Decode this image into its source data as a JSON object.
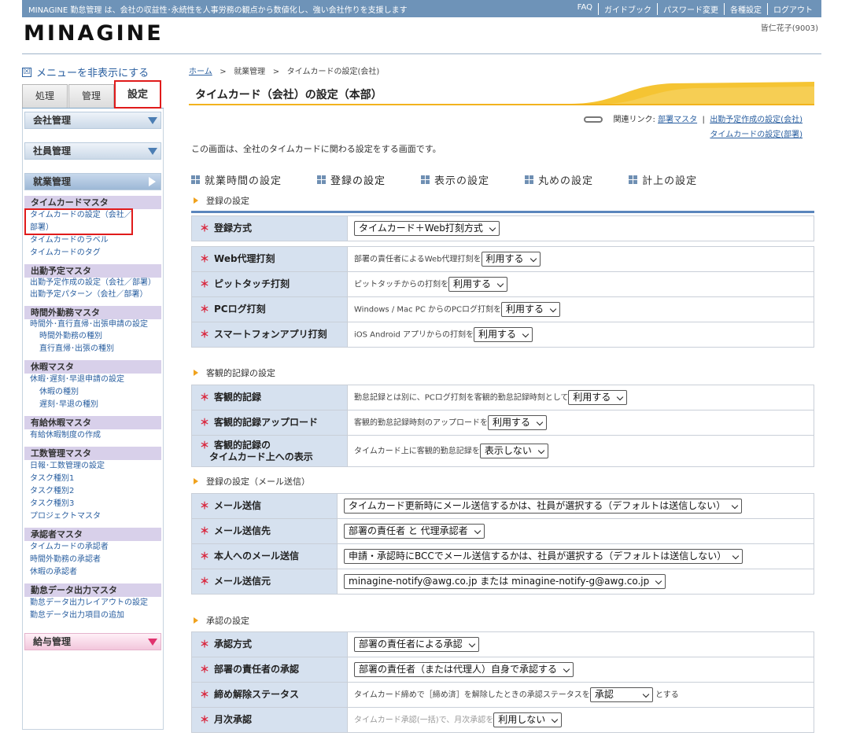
{
  "topbar": {
    "tagline": "MINAGINE 勤怠管理 は、会社の収益性･永続性を人事労務の観点から数値化し、強い会社作りを支援します",
    "links": [
      "FAQ",
      "ガイドブック",
      "パスワード変更",
      "各種設定",
      "ログアウト"
    ]
  },
  "logo": "MINAGINE",
  "user_name": "皆仁花子(9003)",
  "sidebar": {
    "hide_menu_icon": "☒",
    "hide_menu_label": "メニューを非表示にする",
    "tabs": [
      "処理",
      "管理",
      "設定"
    ],
    "heads": {
      "company": "会社管理",
      "employee": "社員管理",
      "attendance": "就業管理",
      "salary": "給与管理"
    },
    "groups": [
      {
        "title": "タイムカードマスタ",
        "links": [
          "タイムカードの設定（会社／部署）",
          "タイムカードのラベル",
          "タイムカードのタグ"
        ]
      },
      {
        "title": "出勤予定マスタ",
        "links": [
          "出勤予定作成の設定（会社／部署）",
          "出勤予定パターン（会社／部署）"
        ]
      },
      {
        "title": "時間外勤務マスタ",
        "links": [
          "時間外･直行直帰･出張申請の設定",
          "時間外勤務の種別",
          "直行直帰･出張の種別"
        ]
      },
      {
        "title": "休暇マスタ",
        "links": [
          "休暇･遅刻･早退申請の設定",
          "休暇の種別",
          "遅刻･早退の種別"
        ]
      },
      {
        "title": "有給休暇マスタ",
        "links": [
          "有給休暇制度の作成"
        ]
      },
      {
        "title": "工数管理マスタ",
        "links": [
          "日報･工数管理の設定",
          "タスク種別1",
          "タスク種別2",
          "タスク種別3",
          "プロジェクトマスタ"
        ]
      },
      {
        "title": "承認者マスタ",
        "links": [
          "タイムカードの承認者",
          "時間外勤務の承認者",
          "休暇の承認者"
        ]
      },
      {
        "title": "勤怠データ出力マスタ",
        "links": [
          "勤怠データ出力レイアウトの設定",
          "勤怠データ出力項目の追加"
        ]
      }
    ]
  },
  "breadcrumb": {
    "home": "ホーム",
    "sep": ">",
    "parent": "就業管理",
    "current": "タイムカードの設定(会社)"
  },
  "page_title": "タイムカード（会社）の設定（本部）",
  "related": {
    "label": "関連リンク:",
    "links": [
      "部署マスタ",
      "出勤予定作成の設定(会社)",
      "タイムカードの設定(部署)"
    ],
    "sep": "|"
  },
  "description": "この画面は、全社のタイムカードに関わる設定をする画面です。",
  "section_nav": [
    "就業時間の設定",
    "登録の設定",
    "表示の設定",
    "丸めの設定",
    "計上の設定"
  ],
  "required_mark": "＊",
  "sections": {
    "registration": {
      "title": "登録の設定",
      "method": {
        "label": "登録方式",
        "value": "タイムカード＋Web打刻方式"
      },
      "rows": [
        {
          "label": "Web代理打刻",
          "text": "部署の責任者によるWeb代理打刻を",
          "value": "利用する"
        },
        {
          "label": "ピットタッチ打刻",
          "text": "ピットタッチからの打刻を",
          "value": "利用する"
        },
        {
          "label": "PCログ打刻",
          "text": "Windows / Mac PC からのPCログ打刻を",
          "value": "利用する"
        },
        {
          "label": "スマートフォンアプリ打刻",
          "text": "iOS Android アプリからの打刻を",
          "value": "利用する"
        }
      ]
    },
    "objective": {
      "title": "客観的記録の設定",
      "rows": [
        {
          "label": "客観的記録",
          "text": "勤怠記録とは別に、PCログ打刻を客観的勤怠記録時刻として",
          "value": "利用する"
        },
        {
          "label": "客観的記録アップロード",
          "text": "客観的勤怠記録時刻のアップロードを",
          "value": "利用する"
        },
        {
          "label_line1": "客観的記録の",
          "label_line2": "タイムカード上への表示",
          "text": "タイムカード上に客観的勤怠記録を",
          "value": "表示しない"
        }
      ]
    },
    "mail": {
      "title": "登録の設定（メール送信）",
      "rows": [
        {
          "label": "メール送信",
          "value": "タイムカード更新時にメール送信するかは、社員が選択する（デフォルトは送信しない）"
        },
        {
          "label": "メール送信先",
          "value": "部署の責任者 と 代理承認者"
        },
        {
          "label": "本人へのメール送信",
          "value": "申請・承認時にBCCでメール送信するかは、社員が選択する（デフォルトは送信しない）"
        },
        {
          "label": "メール送信元",
          "value": "minagine-notify@awg.co.jp または minagine-notify-g@awg.co.jp"
        }
      ]
    },
    "approval": {
      "title": "承認の設定",
      "rows": [
        {
          "label": "承認方式",
          "value": "部署の責任者による承認"
        },
        {
          "label": "部署の責任者の承認",
          "value": "部署の責任者（または代理人）自身で承認する"
        },
        {
          "label": "締め解除ステータス",
          "text": "タイムカード締めで［締め済］を解除したときの承認ステータスを",
          "value": "承認",
          "suffix": "とする"
        },
        {
          "label": "月次承認",
          "text": "タイムカード承認(一括)で、月次承認を",
          "value": "利用しない"
        }
      ]
    }
  }
}
